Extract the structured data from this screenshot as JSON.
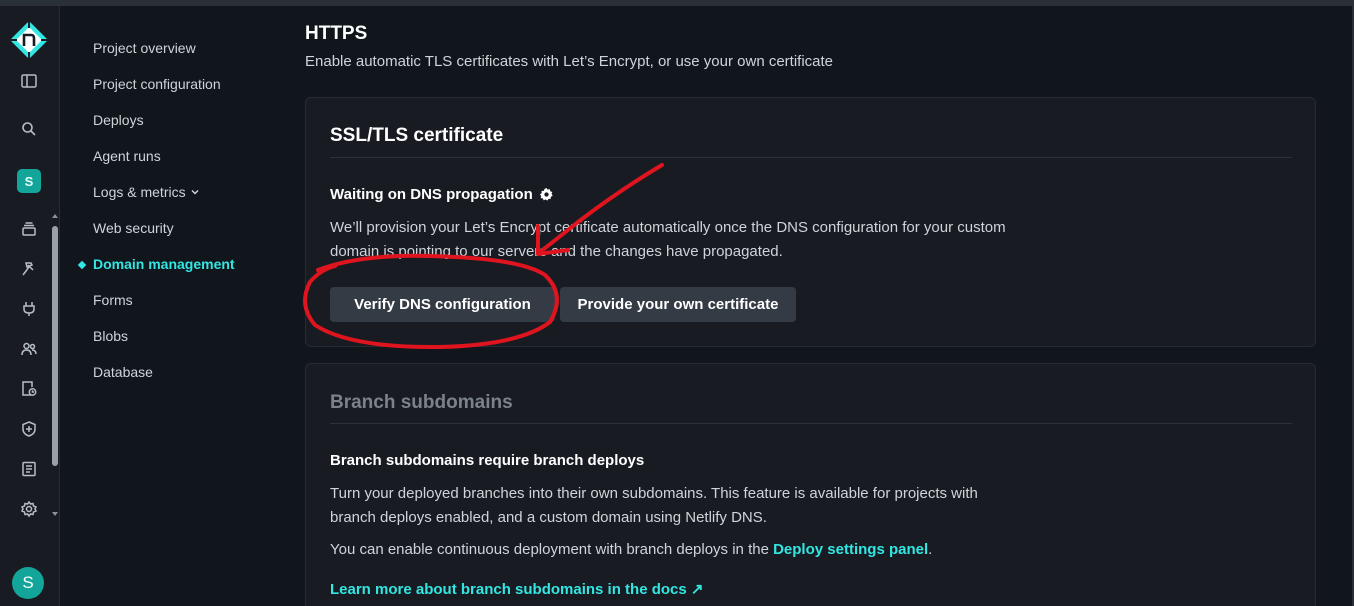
{
  "rail": {
    "icons": [
      "netlify-logo",
      "sidebar-toggle-icon",
      "search-icon",
      "site-badge",
      "stack-icon",
      "hammer-icon",
      "plug-icon",
      "team-icon",
      "clock-file-icon",
      "shield-icon",
      "logs-icon",
      "settings-icon"
    ],
    "site_initial": "S",
    "avatar_initial": "S"
  },
  "nav": {
    "items": [
      {
        "label": "Project overview"
      },
      {
        "label": "Project configuration"
      },
      {
        "label": "Deploys"
      },
      {
        "label": "Agent runs"
      },
      {
        "label": "Logs & metrics"
      },
      {
        "label": "Web security"
      },
      {
        "label": "Domain management"
      },
      {
        "label": "Forms"
      },
      {
        "label": "Blobs"
      },
      {
        "label": "Database"
      }
    ],
    "active": "Domain management"
  },
  "https": {
    "title": "HTTPS",
    "subtitle": "Enable automatic TLS certificates with Let’s Encrypt, or use your own certificate"
  },
  "ssl_card": {
    "title": "SSL/TLS certificate",
    "status_heading": "Waiting on DNS propagation",
    "description": "We’ll provision your Let’s Encrypt certificate automatically once the DNS configuration for your custom domain is pointing to our servers and the changes have propagated.",
    "verify_button": "Verify DNS configuration",
    "own_cert_button": "Provide your own certificate"
  },
  "branch_card": {
    "title": "Branch subdomains",
    "heading": "Branch subdomains require branch deploys",
    "description": "Turn your deployed branches into their own subdomains. This feature is available for projects with branch deploys enabled, and a custom domain using Netlify DNS.",
    "cd_text": "You can enable continuous deployment with branch deploys in the ",
    "cd_link": "Deploy settings panel",
    "cd_end": ".",
    "docs_link": "Learn more about branch subdomains in the docs ↗"
  },
  "colors": {
    "accent": "#32e6e2",
    "annotation": "#e0141e",
    "background": "#11161c",
    "card": "#181c22"
  }
}
